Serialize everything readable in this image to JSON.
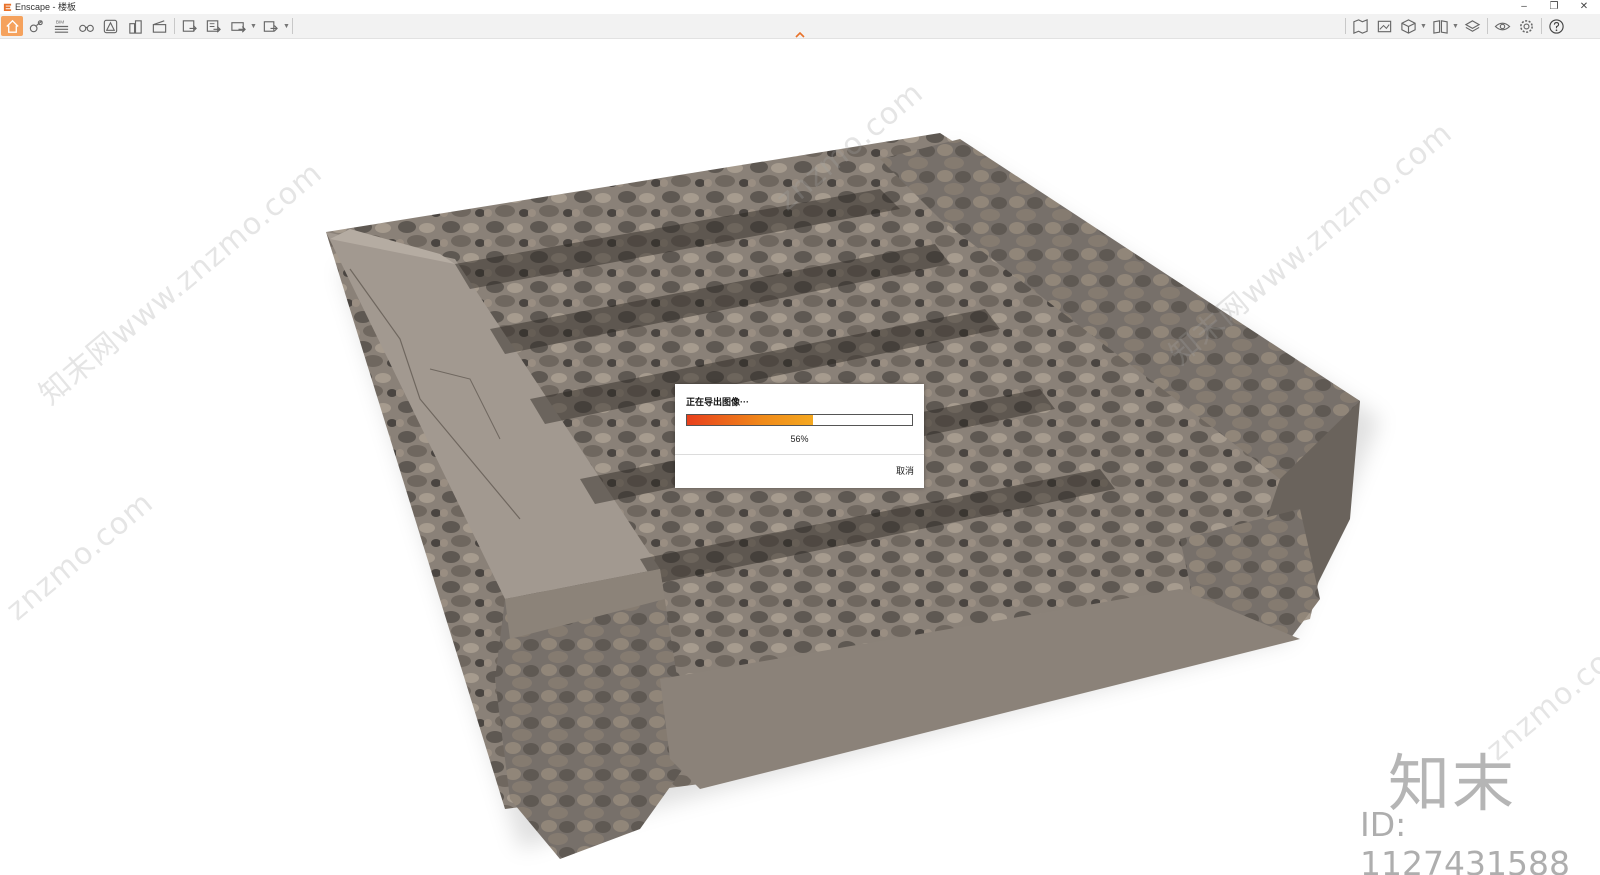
{
  "window": {
    "title": "Enscape - 楼板"
  },
  "window_controls": {
    "minimize": "–",
    "restore": "❐",
    "close": "✕"
  },
  "toolbar": {
    "left_icons": [
      "home-icon",
      "asset-library-icon",
      "bim-icon",
      "binoculars-icon",
      "material-icon",
      "buildings-icon",
      "video-editor-icon",
      "export-screenshot-icon",
      "export-batch-icon",
      "export-panorama-icon",
      "export-exe-icon"
    ],
    "right_icons": [
      "map-icon",
      "image-icon",
      "cube-icon",
      "book-icon",
      "layers-icon",
      "eye-icon",
      "settings-icon",
      "help-icon"
    ],
    "bim_label": "BIM",
    "accent_color": "#f5a25d"
  },
  "dialog": {
    "title": "正在导出图像···",
    "progress_percent": 56,
    "progress_label": "56%",
    "cancel_label": "取消"
  },
  "watermarks": {
    "text_a": "知末网www.znzmo.com",
    "text_b": "znzmo.com",
    "brand_mark": "知末",
    "brand_id": "ID: 1127431588"
  }
}
